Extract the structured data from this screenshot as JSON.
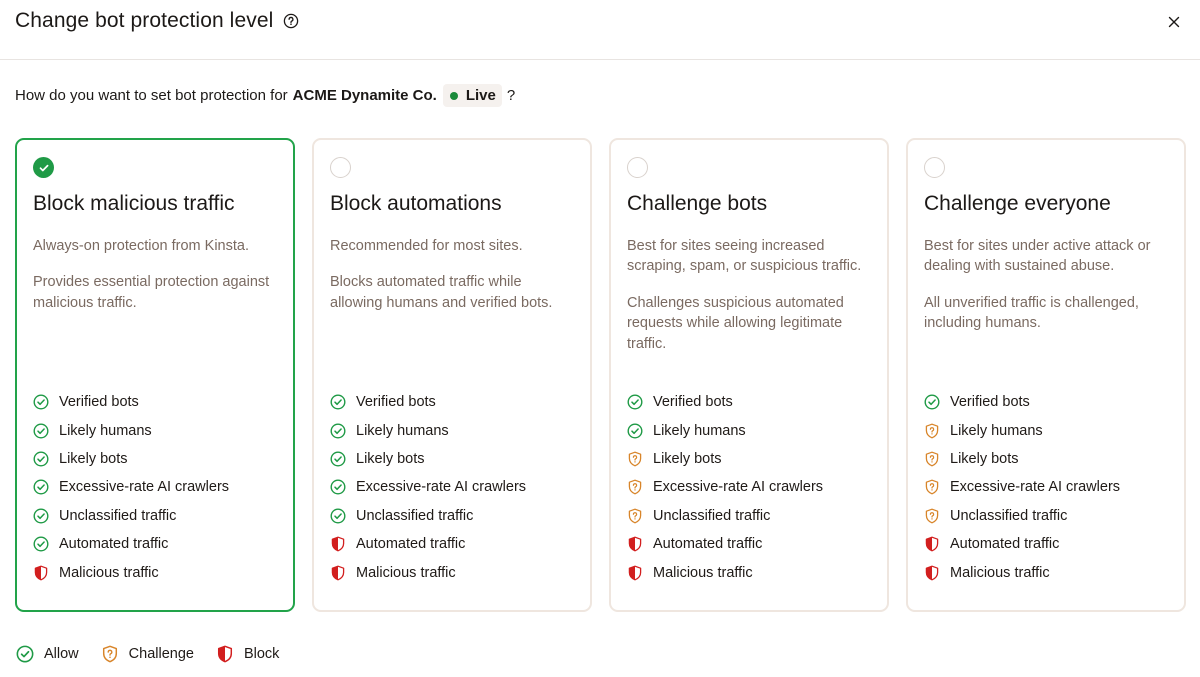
{
  "dialog": {
    "title": "Change bot protection level",
    "help_icon": "help-circle-icon",
    "close_icon": "close-icon"
  },
  "question": {
    "prefix": "How do you want to set bot protection for",
    "site_name": "ACME Dynamite Co.",
    "env_label": "Live",
    "suffix": "?"
  },
  "colors": {
    "allow": "#1f9a46",
    "challenge": "#d8852a",
    "block": "#d21f1f",
    "selected_border": "#22a34a",
    "live_dot": "#1a8a3a"
  },
  "cards": [
    {
      "title": "Block malicious traffic",
      "selected": true,
      "paragraphs": [
        "Always-on protection from Kinsta.",
        "Provides essential protection against malicious traffic."
      ],
      "features": [
        {
          "label": "Verified bots",
          "status": "allow"
        },
        {
          "label": "Likely humans",
          "status": "allow"
        },
        {
          "label": "Likely bots",
          "status": "allow"
        },
        {
          "label": "Excessive-rate AI crawlers",
          "status": "allow"
        },
        {
          "label": "Unclassified traffic",
          "status": "allow"
        },
        {
          "label": "Automated traffic",
          "status": "allow"
        },
        {
          "label": "Malicious traffic",
          "status": "block"
        }
      ]
    },
    {
      "title": "Block automations",
      "selected": false,
      "paragraphs": [
        "Recommended for most sites.",
        "Blocks automated traffic while allowing humans and verified bots."
      ],
      "features": [
        {
          "label": "Verified bots",
          "status": "allow"
        },
        {
          "label": "Likely humans",
          "status": "allow"
        },
        {
          "label": "Likely bots",
          "status": "allow"
        },
        {
          "label": "Excessive-rate AI crawlers",
          "status": "allow"
        },
        {
          "label": "Unclassified traffic",
          "status": "allow"
        },
        {
          "label": "Automated traffic",
          "status": "block"
        },
        {
          "label": "Malicious traffic",
          "status": "block"
        }
      ]
    },
    {
      "title": "Challenge bots",
      "selected": false,
      "paragraphs": [
        "Best for sites seeing increased scraping, spam, or suspicious traffic.",
        "Challenges suspicious automated requests while allowing legitimate traffic."
      ],
      "features": [
        {
          "label": "Verified bots",
          "status": "allow"
        },
        {
          "label": "Likely humans",
          "status": "allow"
        },
        {
          "label": "Likely bots",
          "status": "challenge"
        },
        {
          "label": "Excessive-rate AI crawlers",
          "status": "challenge"
        },
        {
          "label": "Unclassified traffic",
          "status": "challenge"
        },
        {
          "label": "Automated traffic",
          "status": "block"
        },
        {
          "label": "Malicious traffic",
          "status": "block"
        }
      ]
    },
    {
      "title": "Challenge everyone",
      "selected": false,
      "paragraphs": [
        "Best for sites under active attack or dealing with sustained abuse.",
        "All unverified traffic is challenged, including humans."
      ],
      "features": [
        {
          "label": "Verified bots",
          "status": "allow"
        },
        {
          "label": "Likely humans",
          "status": "challenge"
        },
        {
          "label": "Likely bots",
          "status": "challenge"
        },
        {
          "label": "Excessive-rate AI crawlers",
          "status": "challenge"
        },
        {
          "label": "Unclassified traffic",
          "status": "challenge"
        },
        {
          "label": "Automated traffic",
          "status": "block"
        },
        {
          "label": "Malicious traffic",
          "status": "block"
        }
      ]
    }
  ],
  "legend": [
    {
      "label": "Allow",
      "status": "allow"
    },
    {
      "label": "Challenge",
      "status": "challenge"
    },
    {
      "label": "Block",
      "status": "block"
    }
  ]
}
